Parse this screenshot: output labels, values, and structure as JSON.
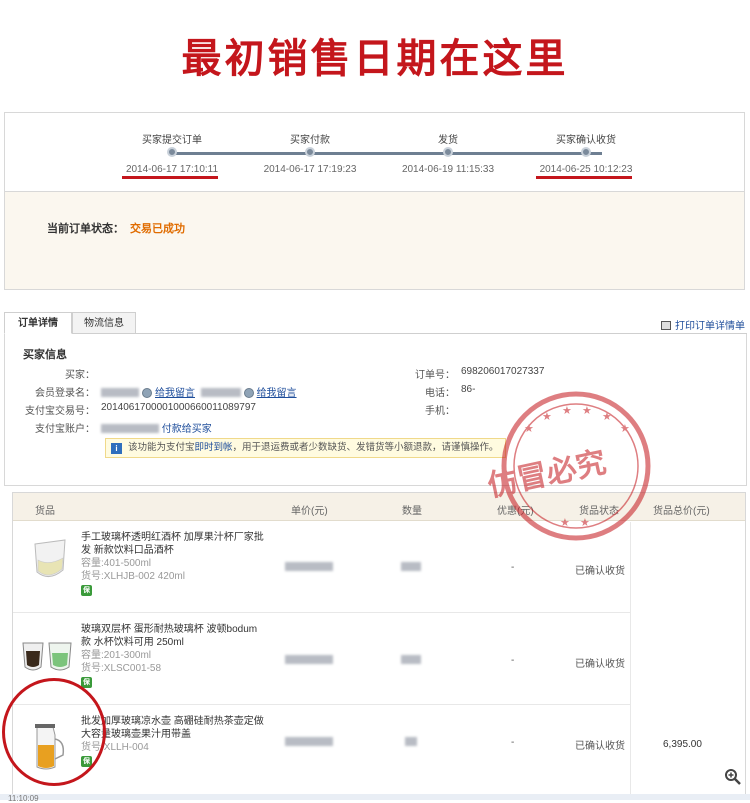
{
  "banner": {
    "title": "最初销售日期在这里"
  },
  "progress": {
    "steps": [
      {
        "label": "买家提交订单",
        "time": "2014-06-17 17:10:11"
      },
      {
        "label": "买家付款",
        "time": "2014-06-17 17:19:23"
      },
      {
        "label": "发货",
        "time": "2014-06-19 11:15:33"
      },
      {
        "label": "买家确认收货",
        "time": "2014-06-25 10:12:23"
      }
    ],
    "colors": {
      "track": "#6e7f92",
      "highlight": "#c4161c"
    }
  },
  "status": {
    "label": "当前订单状态：",
    "value": "交易已成功",
    "value_color": "#e06c00"
  },
  "tabs": {
    "order_detail": "订单详情",
    "logistics": "物流信息",
    "print": "打印订单详情单"
  },
  "buyer": {
    "heading": "买家信息",
    "buyer_label": "买家：",
    "member_label": "会员登录名：",
    "leave_msg_1": "给我留言",
    "leave_msg_2": "给我留言",
    "alipay_trade_label": "支付宝交易号：",
    "alipay_trade_value": "2014061700001000660011089797",
    "alipay_account_label": "支付宝账户：",
    "pay_to_buyer": "付款给买家",
    "order_no_label": "订单号：",
    "order_no_value": "698206017027337",
    "phone_label": "电话：",
    "phone_value": "86-",
    "mobile_label": "手机：",
    "notice_prefix": "该功能为支付宝",
    "notice_link": "即时到帐",
    "notice_suffix": "，用于退运费或者少数缺货、发错货等小额退款，请谨慎操作。"
  },
  "goods": {
    "headers": {
      "item": "货品",
      "unit_price": "单价(元)",
      "quantity": "数量",
      "discount": "优惠(元)",
      "status": "货品状态",
      "total": "货品总价(元)"
    },
    "rows": [
      {
        "title": "手工玻璃杯透明红酒杯 加厚果汁杯厂家批发 新款饮料口品酒杯",
        "spec": "容量:401-500ml",
        "sku": "货号:XLHJB-002 420ml",
        "discount": "-",
        "status": "已确认收货"
      },
      {
        "title": "玻璃双层杯 蛋形耐热玻璃杯 波顿bodum款 水杯饮料可用 250ml",
        "spec": "容量:201-300ml",
        "sku": "货号:XLSC001-58",
        "discount": "-",
        "status": "已确认收货"
      },
      {
        "title": "批发加厚玻璃凉水壶 高硼硅耐热茶壶定做大容量玻璃壶果汁用带盖",
        "spec": "",
        "sku": "货号:XLLH-004",
        "discount": "-",
        "status": "已确认收货"
      }
    ],
    "total_value": "6,395.00"
  },
  "stamp": {
    "text": "仿冒必究",
    "color": "#c4161c"
  },
  "footer": {
    "partial_text": "11:10:09"
  }
}
